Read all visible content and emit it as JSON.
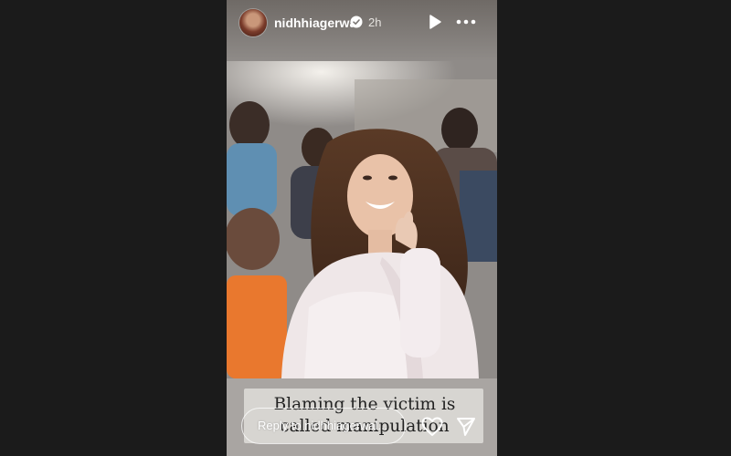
{
  "header": {
    "username": "nidhhiagerwal",
    "time": "2h",
    "verified_icon": "verified-badge-icon",
    "play_icon": "play-icon",
    "more_icon": "more-dots-icon"
  },
  "story": {
    "photo": "woman-in-white-saree-laughing-crowd-photo",
    "caption": "Blaming the victim is called manipulation"
  },
  "footer": {
    "reply_placeholder": "Reply to nidhhiagerwal...",
    "like_icon": "heart-icon",
    "send_icon": "send-icon"
  },
  "colors": {
    "background": "#1b1b1b",
    "caption_bg": "#e1dfdc",
    "text": "#ffffff"
  }
}
